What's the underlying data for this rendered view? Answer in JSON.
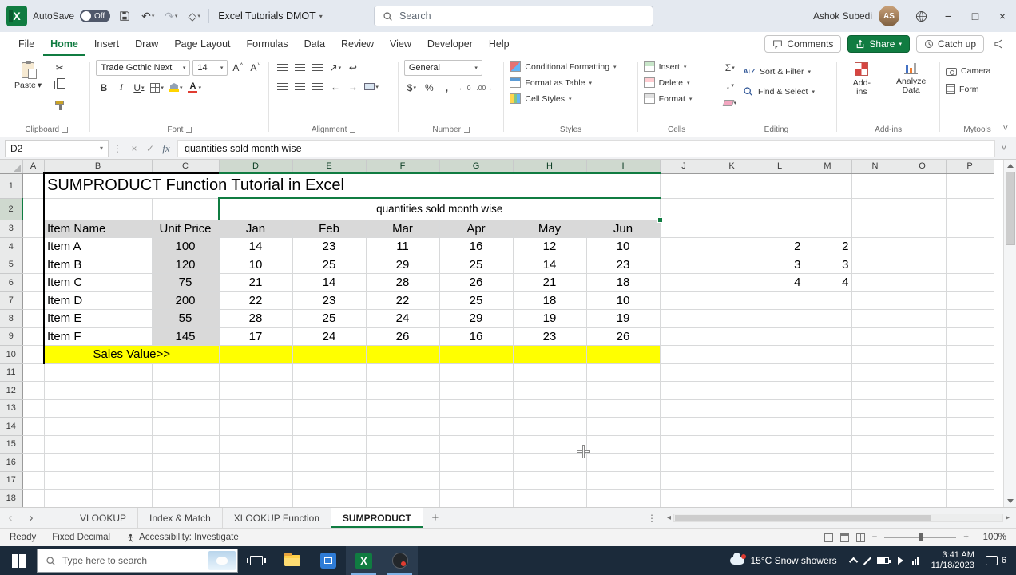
{
  "titlebar": {
    "autosave_label": "AutoSave",
    "autosave_state": "Off",
    "doc_title": "Excel Tutorials DMOT",
    "search_placeholder": "Search",
    "user_name": "Ashok Subedi",
    "user_initials": "AS"
  },
  "menubar": {
    "tabs": [
      "File",
      "Home",
      "Insert",
      "Draw",
      "Page Layout",
      "Formulas",
      "Data",
      "Review",
      "View",
      "Developer",
      "Help"
    ],
    "active_tab": "Home",
    "comments_label": "Comments",
    "share_label": "Share",
    "catchup_label": "Catch up"
  },
  "ribbon": {
    "paste_label": "Paste",
    "clipboard_group": "Clipboard",
    "font_group": "Font",
    "font_name": "Trade Gothic Next",
    "font_size": "14",
    "alignment_group": "Alignment",
    "number_group": "Number",
    "number_format": "General",
    "styles_group": "Styles",
    "styles_items": [
      "Conditional Formatting",
      "Format as Table",
      "Cell Styles"
    ],
    "cells_group": "Cells",
    "cells_items": [
      "Insert",
      "Delete",
      "Format"
    ],
    "editing_group": "Editing",
    "sort_filter_label": "Sort & Filter",
    "find_select_label": "Find & Select",
    "addins_group": "Add-ins",
    "addins_label": "Add-ins",
    "analyze_label": "Analyze Data",
    "mytools_group": "Mytools",
    "camera_label": "Camera",
    "form_label": "Form"
  },
  "formula_bar": {
    "name_box": "D2",
    "formula": "quantities sold month wise"
  },
  "grid": {
    "columns": [
      "A",
      "B",
      "C",
      "D",
      "E",
      "F",
      "G",
      "H",
      "I",
      "J",
      "K",
      "L",
      "M",
      "N",
      "O",
      "P"
    ],
    "row_numbers": [
      "1",
      "2",
      "3",
      "4",
      "5",
      "6",
      "7",
      "8",
      "9",
      "10",
      "11",
      "12",
      "13",
      "14",
      "15",
      "16",
      "17",
      "18"
    ],
    "title": "SUMPRODUCT Function Tutorial in Excel",
    "caption": "quantities sold month wise",
    "headers": [
      "Item Name",
      "Unit Price",
      "Jan",
      "Feb",
      "Mar",
      "Apr",
      "May",
      "Jun"
    ],
    "items": [
      {
        "name": "Item A",
        "price": "100",
        "qty": [
          "14",
          "23",
          "11",
          "16",
          "12",
          "10"
        ]
      },
      {
        "name": "Item B",
        "price": "120",
        "qty": [
          "10",
          "25",
          "29",
          "25",
          "14",
          "23"
        ]
      },
      {
        "name": "Item C",
        "price": "75",
        "qty": [
          "21",
          "14",
          "28",
          "26",
          "21",
          "18"
        ]
      },
      {
        "name": "Item D",
        "price": "200",
        "qty": [
          "22",
          "23",
          "22",
          "25",
          "18",
          "10"
        ]
      },
      {
        "name": "Item E",
        "price": "55",
        "qty": [
          "28",
          "25",
          "24",
          "29",
          "19",
          "19"
        ]
      },
      {
        "name": "Item F",
        "price": "145",
        "qty": [
          "17",
          "24",
          "26",
          "16",
          "23",
          "26"
        ]
      }
    ],
    "sales_label": "Sales Value>>",
    "side_values": [
      [
        "2",
        "2"
      ],
      [
        "3",
        "3"
      ],
      [
        "4",
        "4"
      ]
    ]
  },
  "sheet_tabs": {
    "tabs": [
      "VLOOKUP",
      "Index & Match",
      "XLOOKUP Function",
      "SUMPRODUCT"
    ],
    "active": "SUMPRODUCT"
  },
  "status_bar": {
    "ready": "Ready",
    "fixed_decimal": "Fixed Decimal",
    "accessibility": "Accessibility: Investigate",
    "zoom": "100%"
  },
  "taskbar": {
    "search_placeholder": "Type here to search",
    "weather": "15°C Snow showers",
    "time": "3:41 AM",
    "date": "11/18/2023",
    "badge_count": "6"
  }
}
